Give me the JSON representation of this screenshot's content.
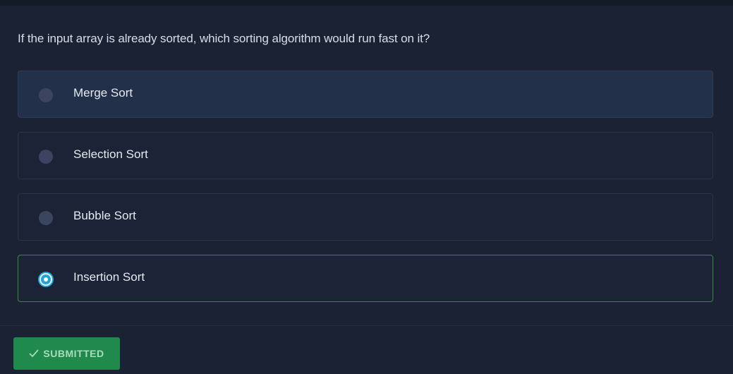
{
  "question": {
    "text": "If the input array is already sorted, which sorting algorithm would run fast on it?"
  },
  "options": [
    {
      "label": "Merge Sort",
      "selected": false
    },
    {
      "label": "Selection Sort",
      "selected": false
    },
    {
      "label": "Bubble Sort",
      "selected": false
    },
    {
      "label": "Insertion Sort",
      "selected": true
    }
  ],
  "submit": {
    "label": "SUBMITTED",
    "icon": "check-icon"
  },
  "colors": {
    "background": "#1b2234",
    "selected_border": "#2f8f3e",
    "radio_checked": "#1fa3d8",
    "submit_bg": "#1f8a4c"
  }
}
